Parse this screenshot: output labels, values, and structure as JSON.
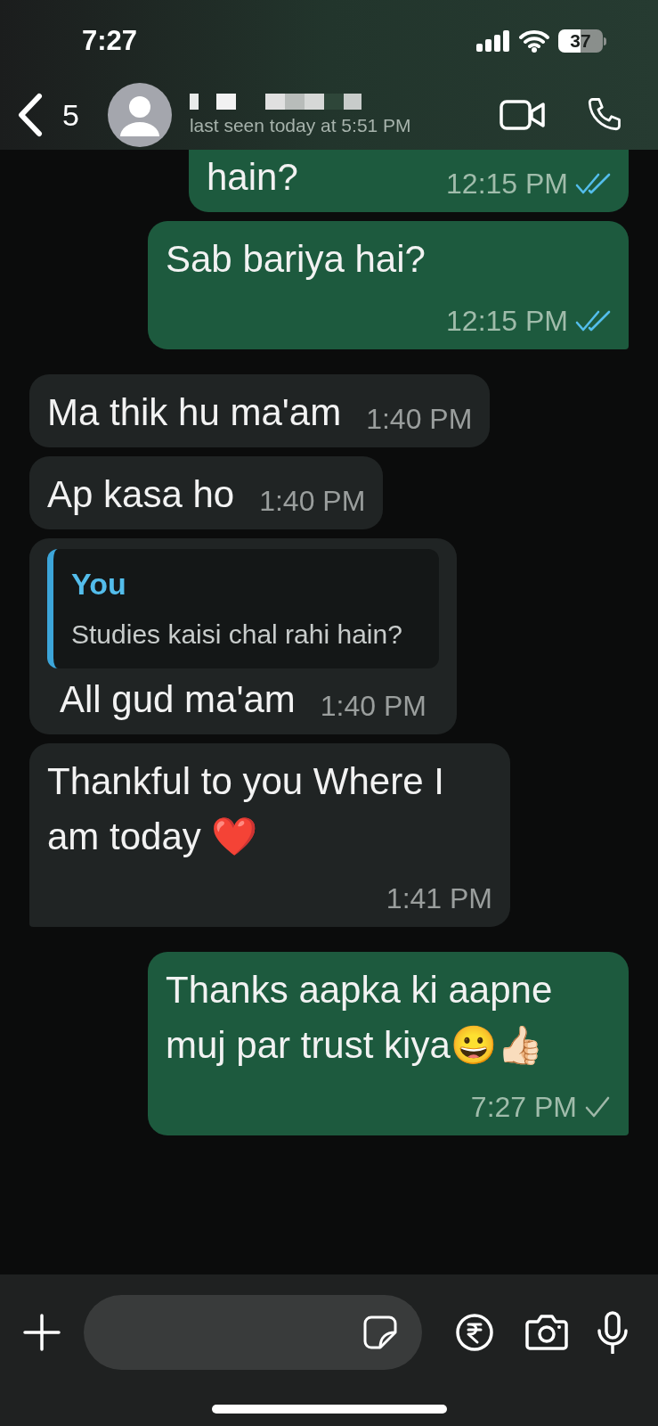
{
  "status_bar": {
    "time": "7:27",
    "battery": "37"
  },
  "header": {
    "back_count": "5",
    "last_seen": "last seen today at 5:51 PM"
  },
  "messages": [
    {
      "kind": "outgoing",
      "text": "hain?",
      "time": "12:15 PM",
      "read": true,
      "cut_top": true
    },
    {
      "kind": "outgoing",
      "text": "Sab bariya hai?",
      "time": "12:15 PM",
      "read": true,
      "tail": true
    },
    {
      "kind": "incoming",
      "text": "Ma thik hu ma'am",
      "time": "1:40 PM"
    },
    {
      "kind": "incoming",
      "text": "Ap kasa ho",
      "time": "1:40 PM"
    },
    {
      "kind": "incoming",
      "quote": {
        "author": "You",
        "text": "Studies kaisi chal rahi hain?"
      },
      "text": "All gud ma'am",
      "time": "1:40 PM"
    },
    {
      "kind": "incoming",
      "text": "Thankful to you Where I am today ❤️",
      "time": "1:41 PM",
      "tail": true
    },
    {
      "kind": "outgoing",
      "text": "Thanks aapka ki aapne muj par trust kiya😀👍🏻",
      "time": "7:27 PM",
      "read": false,
      "tail": true
    }
  ]
}
